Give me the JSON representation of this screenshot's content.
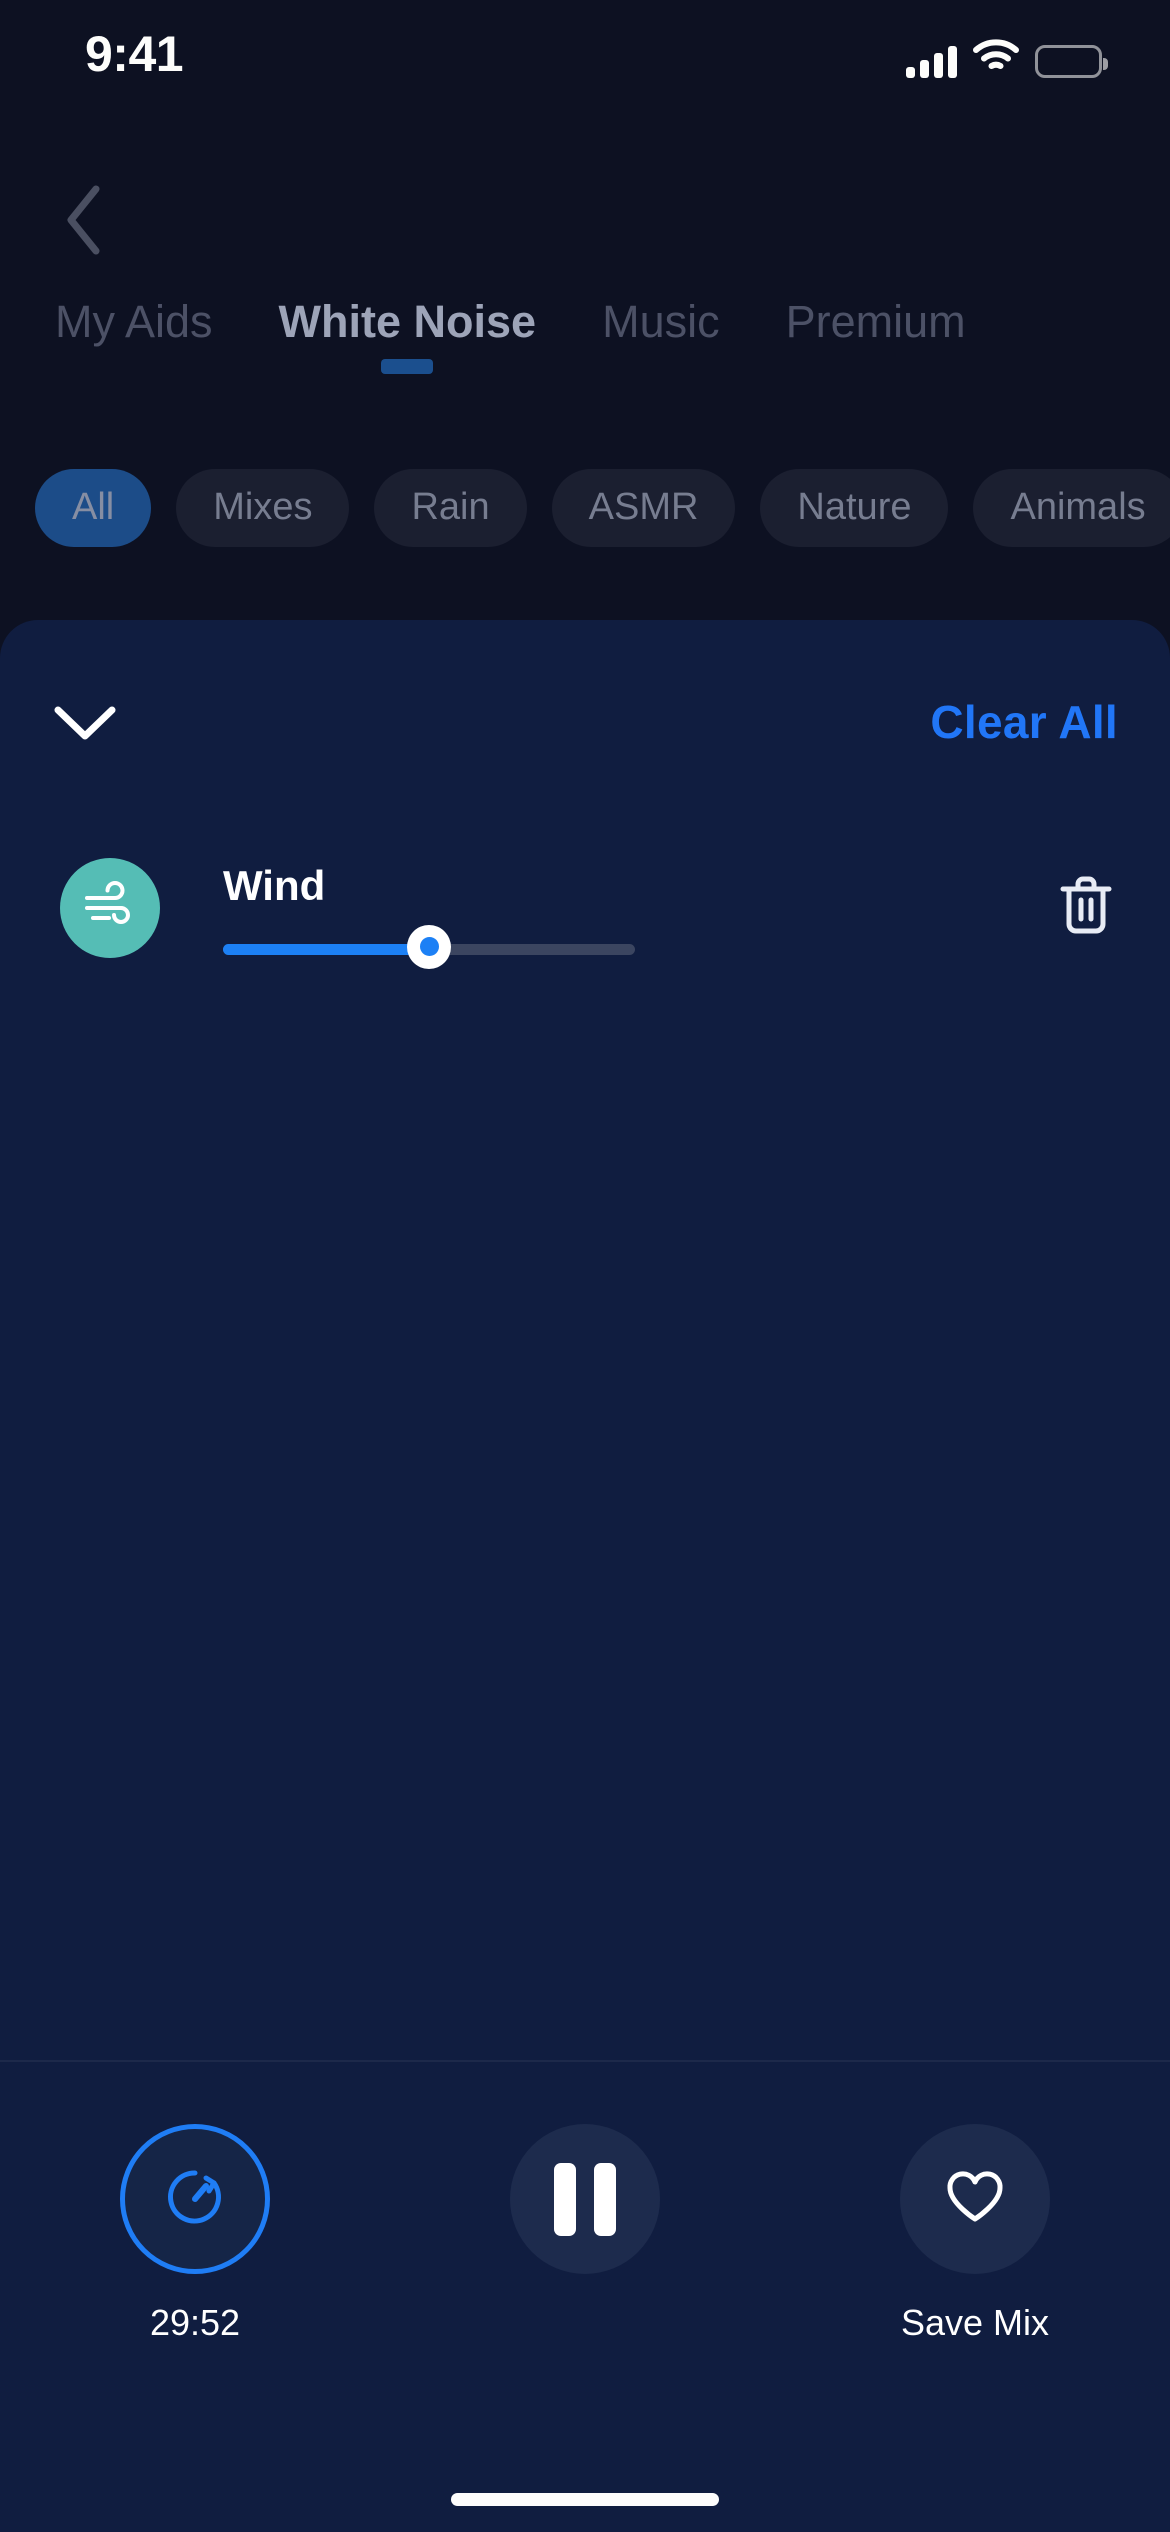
{
  "status_bar": {
    "time": "9:41",
    "cellular_icon": "signal-bars-icon",
    "wifi_icon": "wifi-icon",
    "battery_icon": "battery-full-icon"
  },
  "background_page": {
    "back_icon": "chevron-left-icon",
    "tabs": [
      {
        "label": "My Aids",
        "active": false
      },
      {
        "label": "White Noise",
        "active": true
      },
      {
        "label": "Music",
        "active": false
      },
      {
        "label": "Premium",
        "active": false
      }
    ],
    "filter_chips": [
      {
        "label": "All",
        "selected": true
      },
      {
        "label": "Mixes",
        "selected": false
      },
      {
        "label": "Rain",
        "selected": false
      },
      {
        "label": "ASMR",
        "selected": false
      },
      {
        "label": "Nature",
        "selected": false
      },
      {
        "label": "Animals",
        "selected": false
      }
    ]
  },
  "mixer_panel": {
    "collapse_icon": "chevron-down-icon",
    "clear_all_label": "Clear All",
    "sounds": [
      {
        "name": "Wind",
        "icon": "wind-icon",
        "icon_color": "#55bdb5",
        "volume_percent": 50,
        "delete_icon": "trash-icon"
      }
    ]
  },
  "playback_bar": {
    "timer": {
      "icon": "timer-icon",
      "label": "29:52",
      "ring_color": "#1f7df5"
    },
    "play_pause": {
      "icon": "pause-icon",
      "label": ""
    },
    "save_mix": {
      "icon": "heart-icon",
      "label": "Save Mix"
    }
  },
  "home_indicator": "home-indicator"
}
